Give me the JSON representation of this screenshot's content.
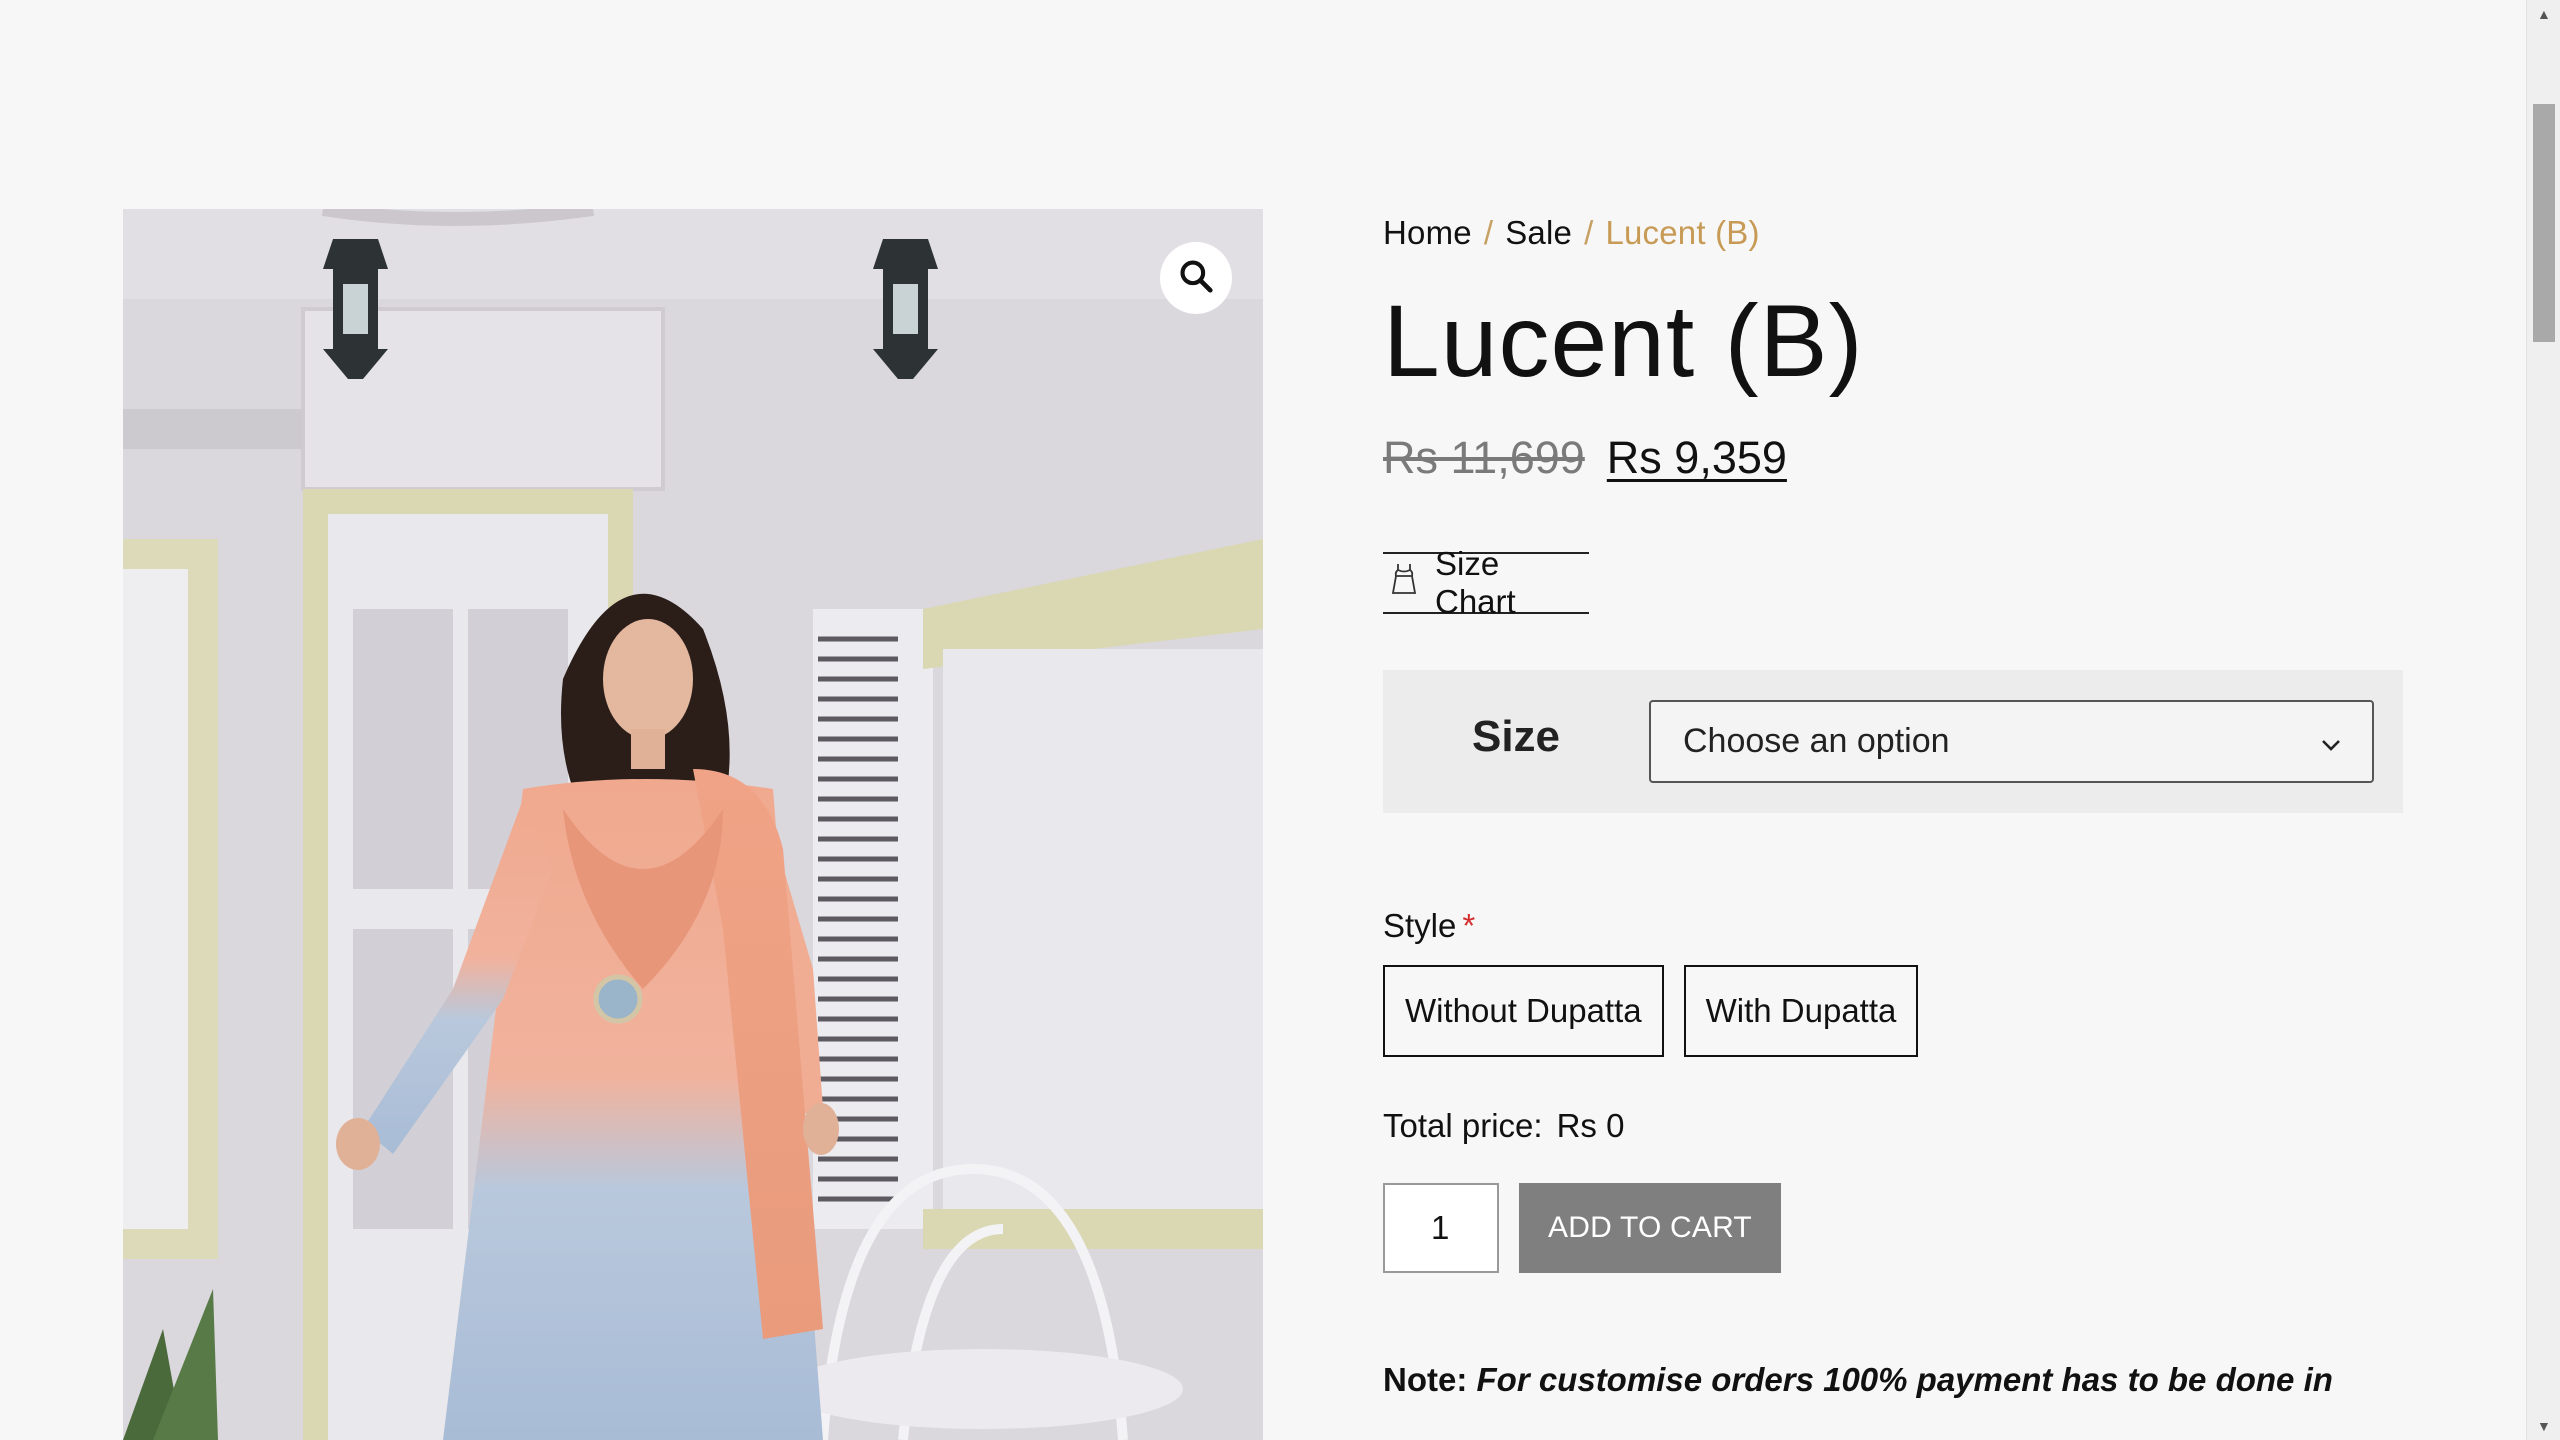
{
  "breadcrumb": {
    "home": "Home",
    "sale": "Sale",
    "current": "Lucent (B)",
    "separator": "/"
  },
  "product": {
    "title": "Lucent (B)",
    "price_old": "Rs 11,699",
    "price_new": "Rs 9,359"
  },
  "size_chart": {
    "label": "Size Chart",
    "icon": "dress-icon"
  },
  "variations": {
    "size_label": "Size",
    "size_select_value": "Choose an option"
  },
  "style": {
    "label": "Style",
    "required_mark": "*",
    "options": [
      "Without Dupatta",
      "With Dupatta"
    ]
  },
  "total": {
    "label": "Total price:",
    "value": "Rs 0"
  },
  "cart": {
    "quantity": "1",
    "add_label": "ADD TO CART"
  },
  "note": {
    "label": "Note:",
    "text": "For customise orders 100% payment has to be done in"
  },
  "colors": {
    "accent": "#c79a55",
    "required": "#d32f2f",
    "button": "#7f7f7f",
    "background": "#f7f7f7"
  },
  "icons": {
    "zoom": "magnifier-icon",
    "select": "chevron-down-icon"
  }
}
